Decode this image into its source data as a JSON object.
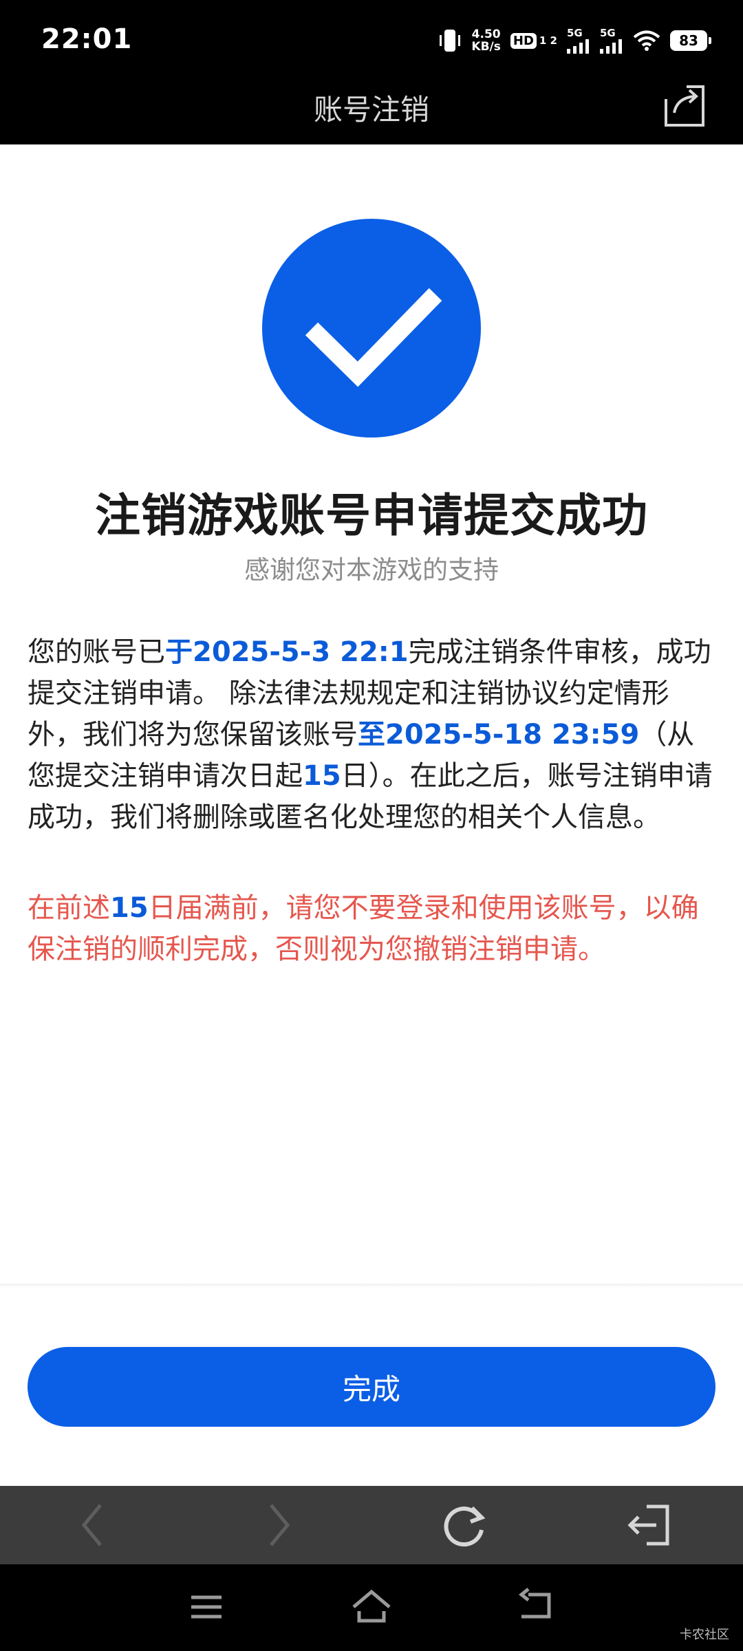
{
  "status_bar": {
    "time": "22:01",
    "net_speed_value": "4.50",
    "net_speed_unit": "KB/s",
    "hd_label": "HD",
    "hd_sub": "1 2",
    "sim1_label": "5G",
    "sim2_label": "5G",
    "battery": "83"
  },
  "header": {
    "title": "账号注销",
    "share_icon": "share-icon"
  },
  "result": {
    "icon": "check-circle-icon",
    "accent_color": "#0b5fe6",
    "headline": "注销游戏账号申请提交成功",
    "subtitle": "感谢您对本游戏的支持"
  },
  "body": {
    "p1_a": "您的账号已",
    "p1_date": "于2025-5-3 22:1",
    "p1_b": "完成注销条件审核，成功提交注销申请。 除法律法规规定和注销协议约定情形外，我们将为您保留该账号",
    "p1_until": "至2025-5-18 23:59",
    "p1_c": "（从您提交注销申请次日起",
    "p1_days": "15",
    "p1_d": "日）。在此之后，账号注销申请成功，我们将删除或匿名化处理您的相关个人信息。",
    "warn_a": "在前述",
    "warn_days": "15",
    "warn_b": "日届满前，请您不要登录和使用该账号，以确保注销的顺利完成，否则视为您撤销注销申请。"
  },
  "actions": {
    "done_label": "完成"
  },
  "browser_toolbar": {
    "back_icon": "back-icon",
    "forward_icon": "forward-icon",
    "refresh_icon": "refresh-icon",
    "exit_icon": "exit-icon"
  },
  "system_nav": {
    "menu_icon": "menu-icon",
    "home_icon": "home-icon",
    "return_icon": "return-icon"
  },
  "watermark": "卡农社区"
}
